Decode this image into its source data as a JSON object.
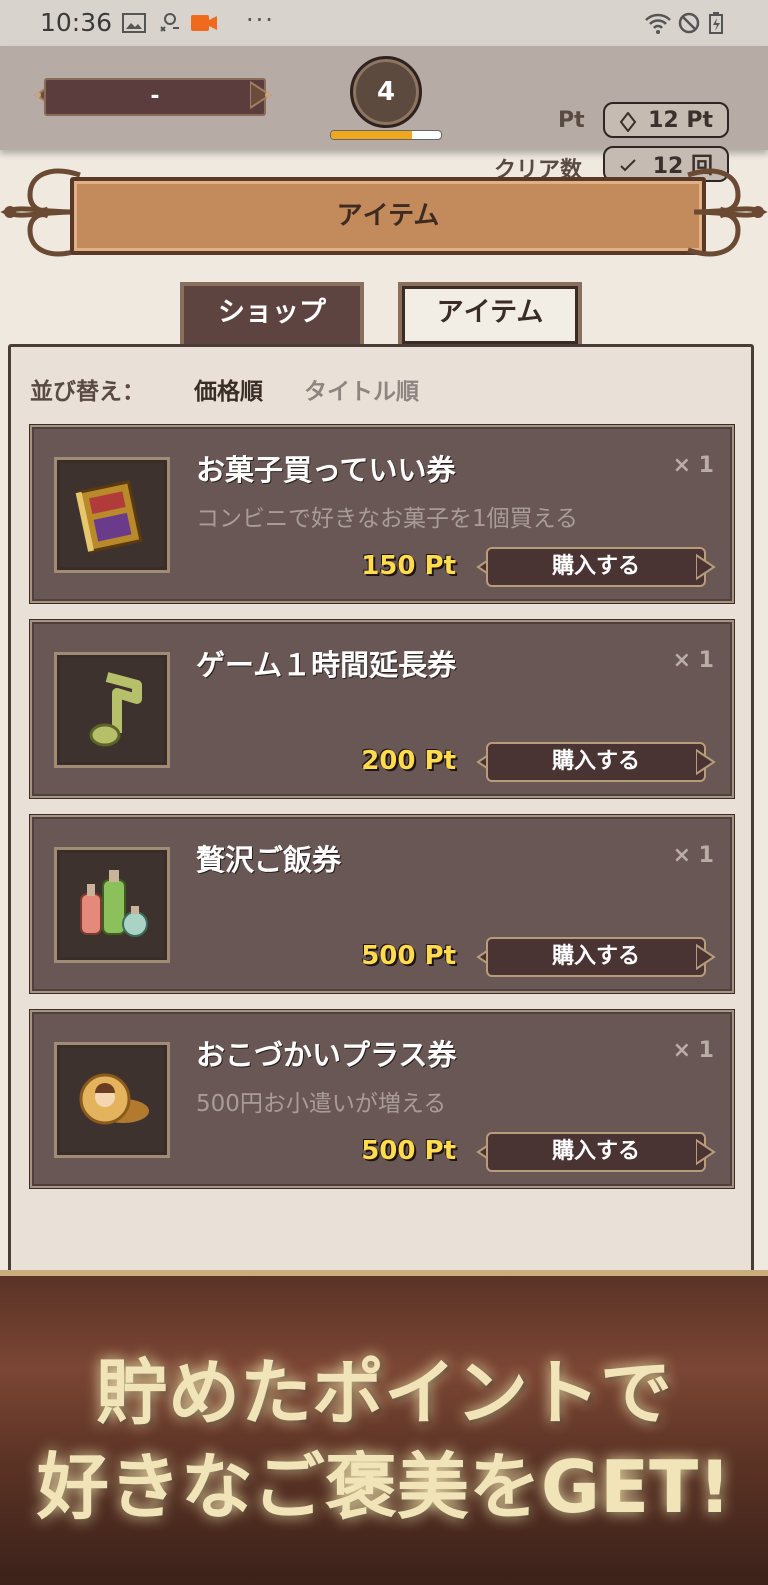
{
  "status_bar": {
    "time": "10:36",
    "dots": "···"
  },
  "header": {
    "player_name": "-",
    "level": "4",
    "level_progress": 0.74,
    "pt_label": "Pt",
    "pt_value": "12 Pt",
    "clear_label": "クリア数",
    "clear_value": "12 回"
  },
  "title_banner": {
    "text": "アイテム"
  },
  "tabs": [
    {
      "label": "ショップ",
      "active": false
    },
    {
      "label": "アイテム",
      "active": true
    }
  ],
  "sort": {
    "label": "並び替え：",
    "options": [
      {
        "label": "価格順",
        "selected": true
      },
      {
        "label": "タイトル順",
        "selected": false
      }
    ]
  },
  "items": [
    {
      "name": "お菓子買っていい券",
      "description": "コンビニで好きなお菓子を1個買える",
      "price": "150 Pt",
      "qty": "× 1",
      "button": "購入する",
      "icon": "book-icon"
    },
    {
      "name": "ゲーム１時間延長券",
      "description": "",
      "price": "200 Pt",
      "qty": "× 1",
      "button": "購入する",
      "icon": "music-note-icon"
    },
    {
      "name": "贅沢ご飯券",
      "description": "",
      "price": "500 Pt",
      "qty": "× 1",
      "button": "購入する",
      "icon": "potion-bottles-icon"
    },
    {
      "name": "おこづかいプラス券",
      "description": "500円お小遣いが増える",
      "price": "500 Pt",
      "qty": "× 1",
      "button": "購入する",
      "icon": "gold-coin-icon"
    }
  ],
  "promo": {
    "line1": "貯めたポイントで",
    "line2": "好きなご褒美をGET!"
  },
  "colors": {
    "accent_gold": "#ffdb4d",
    "card_bg": "#685755",
    "banner_bg": "#c38a5b",
    "progress_fill": "#f0a81f"
  }
}
